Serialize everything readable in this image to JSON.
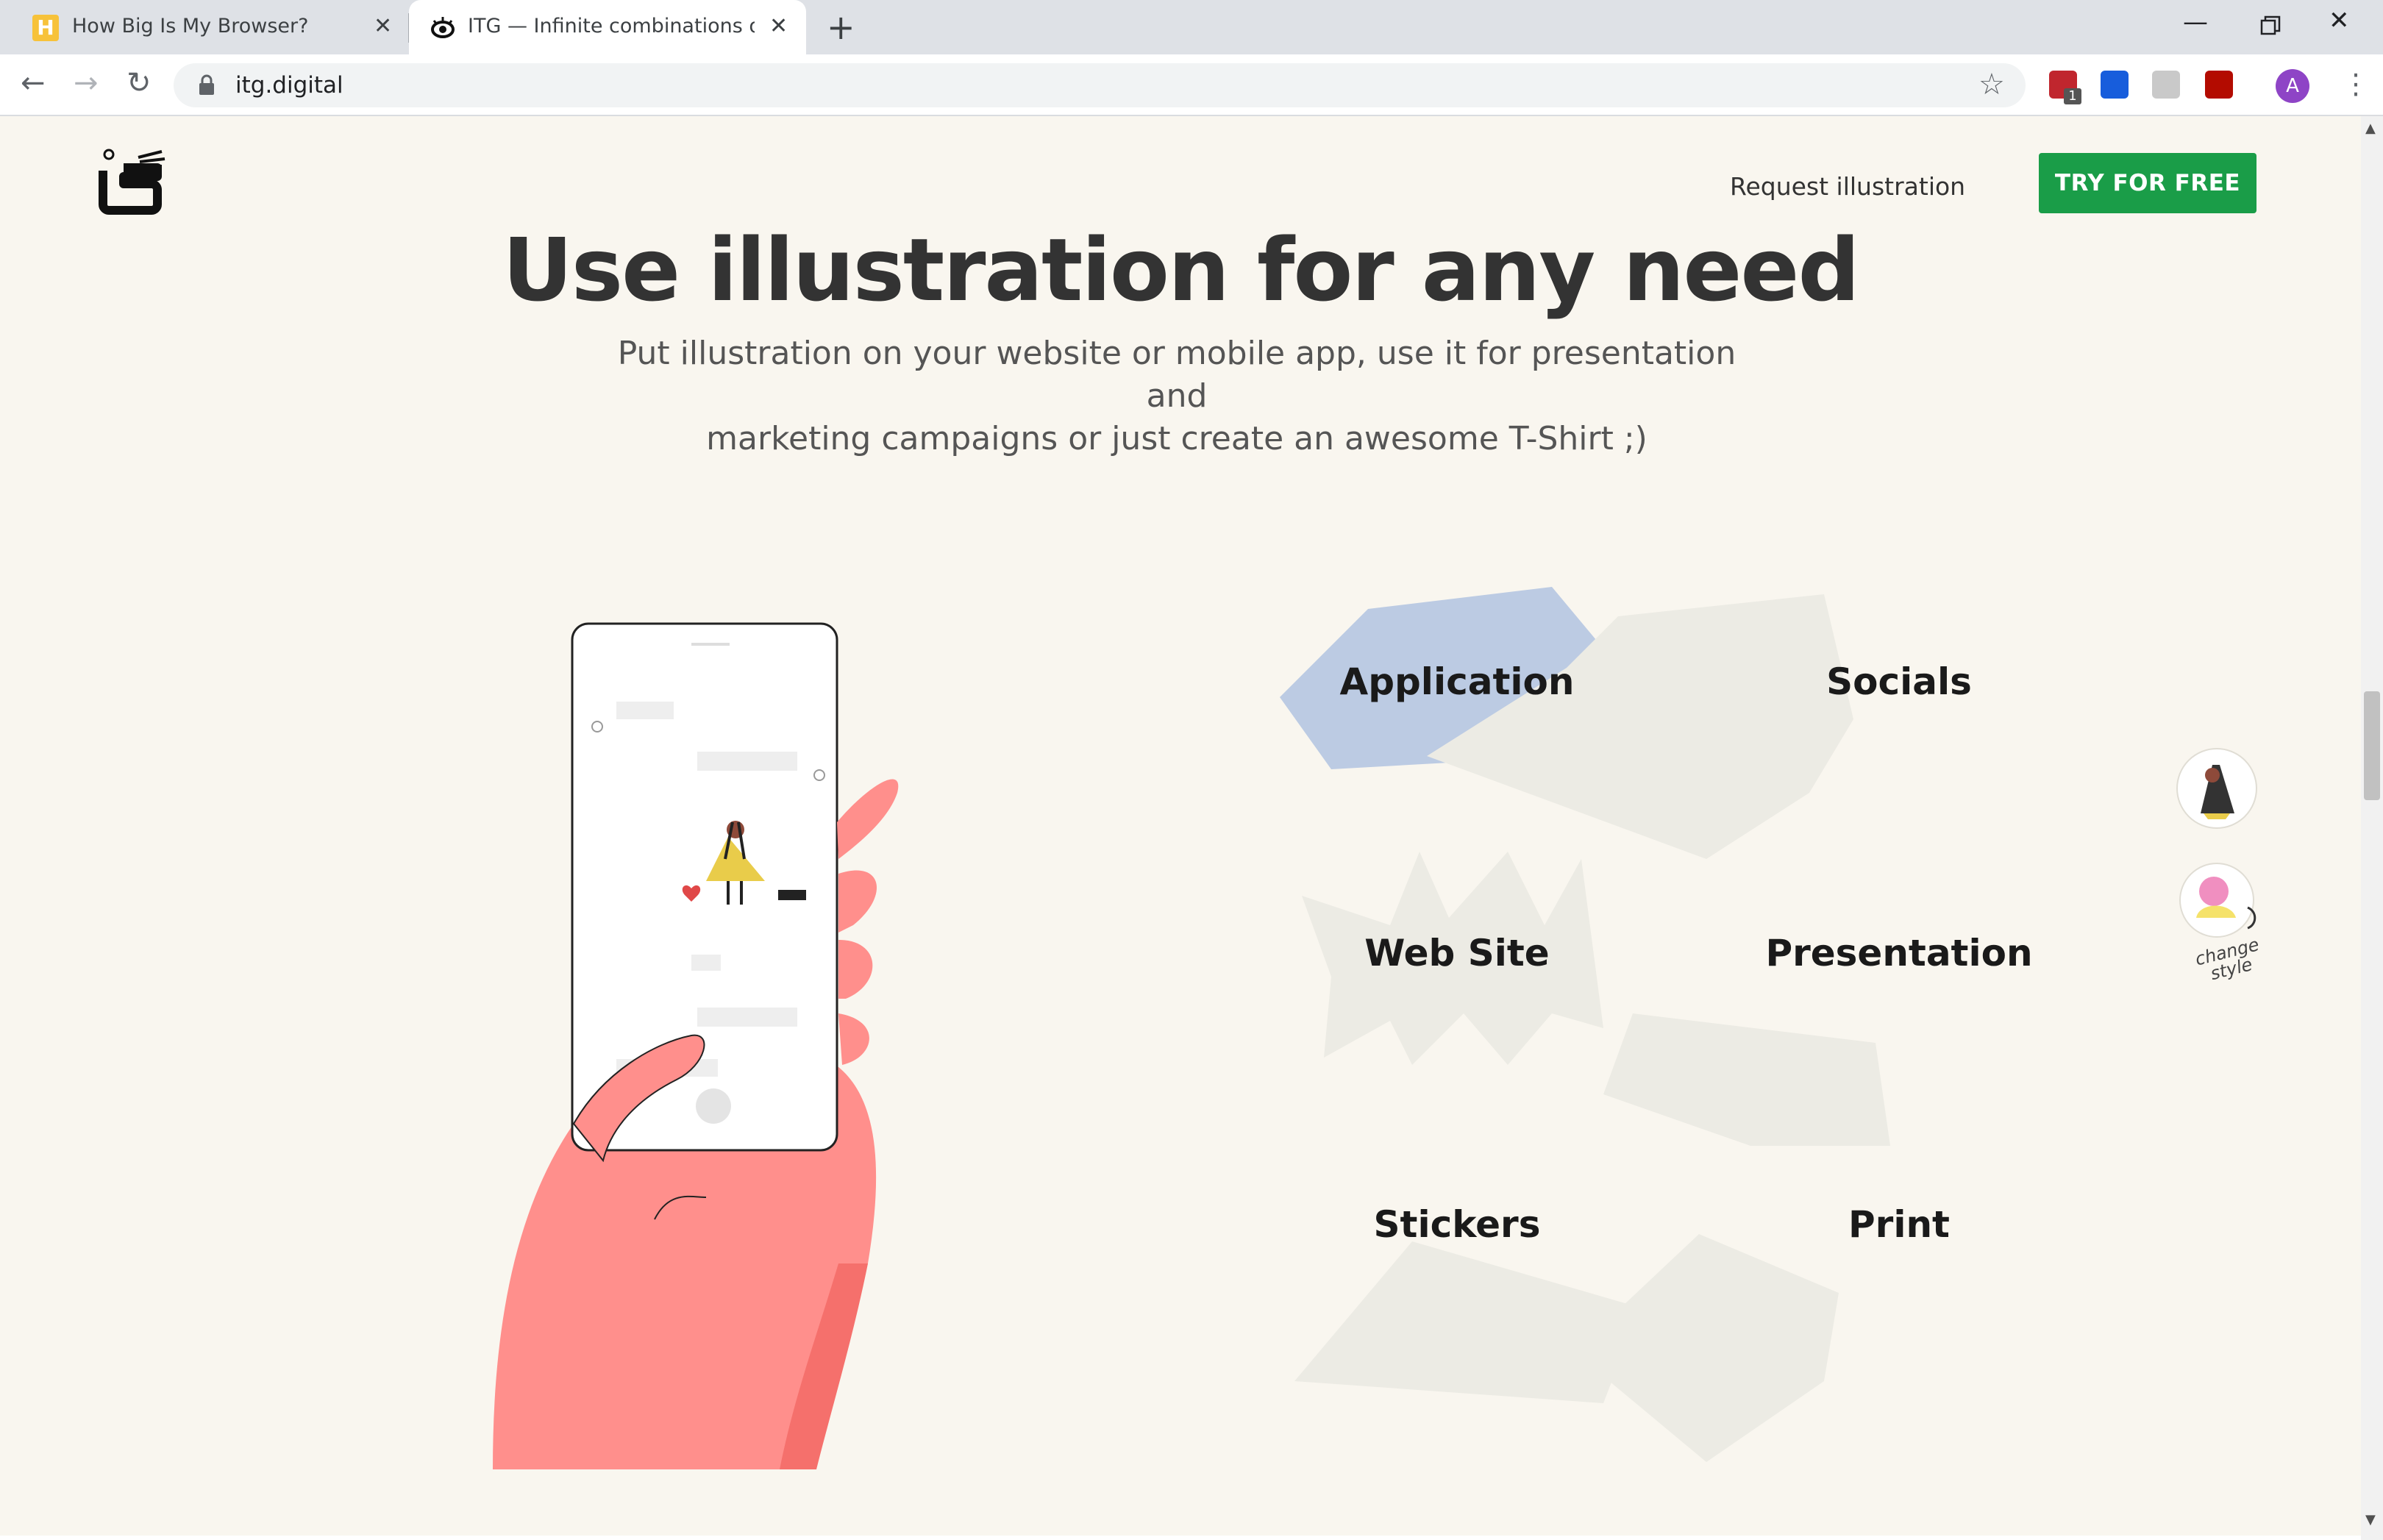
{
  "browser": {
    "tabs": [
      {
        "title": "How Big Is My Browser?",
        "favicon": "H",
        "active": false
      },
      {
        "title": "ITG — Infinite combinations of illustrations",
        "favicon": "eye-icon",
        "active": true
      }
    ],
    "new_tab_label": "+",
    "url": "itg.digital",
    "avatar_letter": "A"
  },
  "header": {
    "request_label": "Request illustration",
    "cta_label": "TRY FOR FREE"
  },
  "hero": {
    "title": "Use illustration for any need",
    "subtitle_line1": "Put illustration on your website or mobile app, use it for presentation and",
    "subtitle_line2": "marketing campaigns or just create an awesome T-Shirt ;)"
  },
  "use_cases": [
    {
      "label": "Application",
      "selected": true
    },
    {
      "label": "Socials",
      "selected": false
    },
    {
      "label": "Web Site",
      "selected": false
    },
    {
      "label": "Presentation",
      "selected": false
    },
    {
      "label": "Stickers",
      "selected": false
    },
    {
      "label": "Print",
      "selected": false
    }
  ],
  "style_switch": {
    "label_line1": "change",
    "label_line2": "style"
  },
  "colors": {
    "page_bg": "#f9f6ef",
    "cta_green": "#1a9d48",
    "selected_shape": "#bccbe3",
    "shape_bg": "#ecebe4",
    "hand": "#ff8f8c",
    "title": "#333333"
  }
}
